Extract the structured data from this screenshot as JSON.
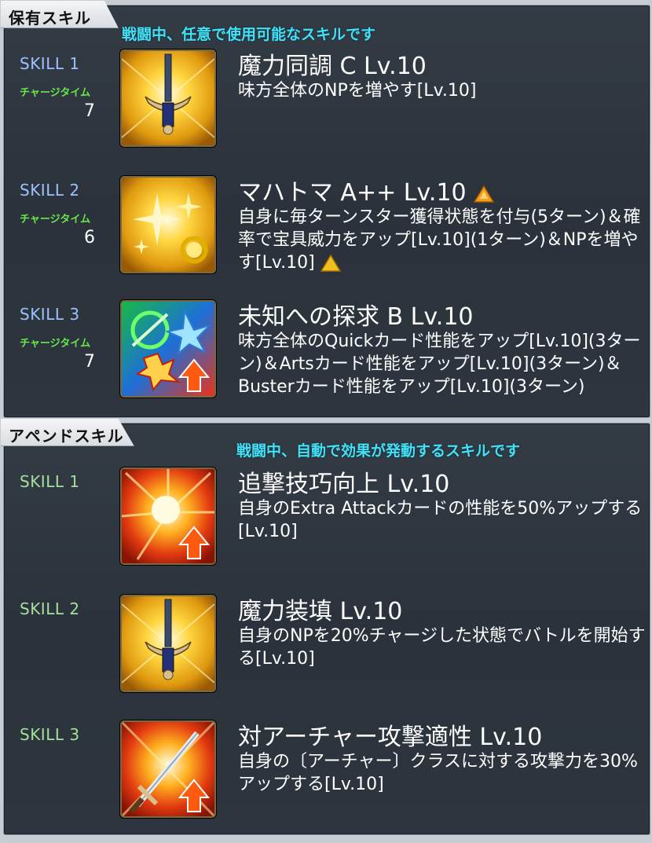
{
  "owned": {
    "tab": "保有スキル",
    "subtitle": "戦闘中、任意で使用可能なスキルです",
    "skills": [
      {
        "label": "SKILL 1",
        "charge_label": "チャージタイム",
        "charge_value": "7",
        "icon": "sword-np-icon",
        "name": "魔力同調 C Lv.10",
        "desc": "味方全体のNPを増やす[Lv.10]"
      },
      {
        "label": "SKILL 2",
        "charge_label": "チャージタイム",
        "charge_value": "6",
        "icon": "star-regen-icon",
        "name": "マハトマ A++ Lv.10",
        "desc": "自身に毎ターンスター獲得状態を付与(5ターン)＆確率で宝具威力をアップ[Lv.10](1ターン)＆NPを増やす[Lv.10]"
      },
      {
        "label": "SKILL 3",
        "charge_label": "チャージタイム",
        "charge_value": "7",
        "icon": "card-buff-icon",
        "name": "未知への探求 B Lv.10",
        "desc": "味方全体のQuickカード性能をアップ[Lv.10](3ターン)＆Artsカード性能をアップ[Lv.10](3ターン)＆Busterカード性能をアップ[Lv.10](3ターン)"
      }
    ]
  },
  "append": {
    "tab": "アペンドスキル",
    "subtitle": "戦闘中、自動で効果が発動するスキルです",
    "skills": [
      {
        "label": "SKILL 1",
        "icon": "extra-attack-up-icon",
        "name": "追撃技巧向上 Lv.10",
        "desc": "自身のExtra Attackカードの性能を50%アップする[Lv.10]"
      },
      {
        "label": "SKILL 2",
        "icon": "sword-np-icon",
        "name": "魔力装填 Lv.10",
        "desc": "自身のNPを20%チャージした状態でバトルを開始する[Lv.10]"
      },
      {
        "label": "SKILL 3",
        "icon": "sword-attack-up-icon",
        "name": "対アーチャー攻撃適性 Lv.10",
        "desc": "自身の〔アーチャー〕クラスに対する攻撃力を30%アップする[Lv.10]"
      }
    ]
  },
  "colors": {
    "subtitle": "#43e0f6",
    "owned_skill_label": "#9cc1ff",
    "append_skill_label": "#a5df9d",
    "charge_label": "#66e84a",
    "upgrade_triangle": "#f0a020"
  }
}
